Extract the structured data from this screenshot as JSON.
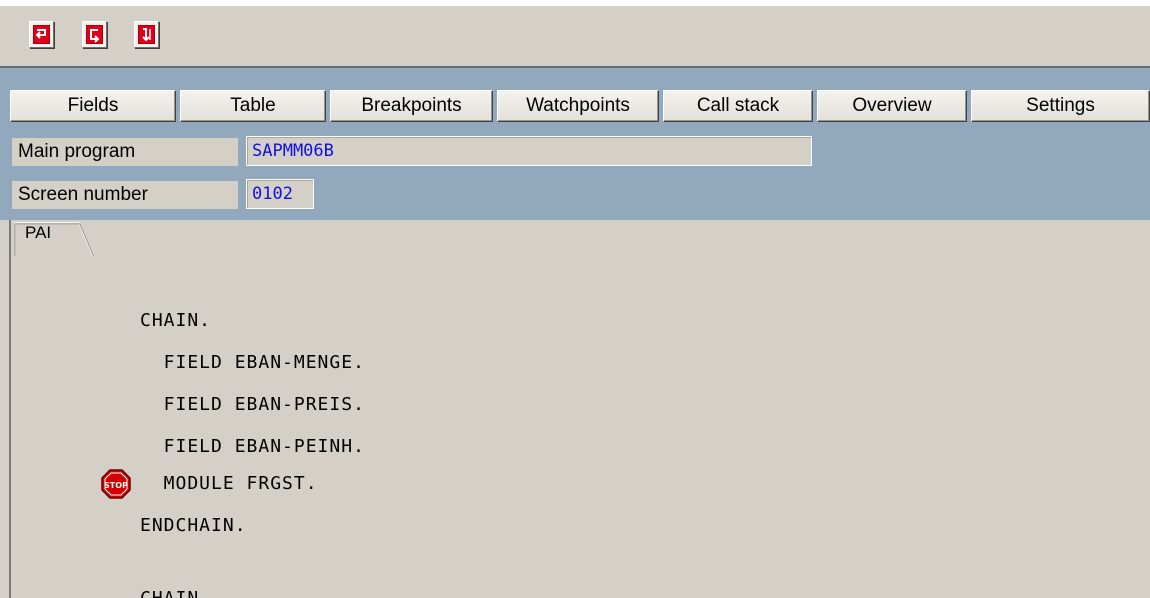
{
  "toolbar": {
    "buttons": [
      {
        "icon": "return-arrow-icon"
      },
      {
        "icon": "continue-loop-icon"
      },
      {
        "icon": "return-down-icon"
      }
    ]
  },
  "tabs": [
    {
      "label": "Fields"
    },
    {
      "label": "Table"
    },
    {
      "label": "Breakpoints"
    },
    {
      "label": "Watchpoints"
    },
    {
      "label": "Call stack"
    },
    {
      "label": "Overview"
    },
    {
      "label": "Settings"
    }
  ],
  "fields": {
    "main_program": {
      "label": "Main program",
      "value": "SAPMM06B"
    },
    "screen_number": {
      "label": "Screen number",
      "value": "0102"
    }
  },
  "pane": {
    "tab_label": "PAI",
    "lines": [
      "CHAIN.",
      "  FIELD EBAN-MENGE.",
      "  FIELD EBAN-PREIS.",
      "  FIELD EBAN-PEINH.",
      "  MODULE FRGST.",
      "ENDCHAIN.",
      "",
      "CHAIN."
    ],
    "breakpoint_icon": "stop-sign-icon"
  },
  "colors": {
    "header_blue": "#92a8bd",
    "value_blue": "#1010e0",
    "stop_red": "#d20000"
  }
}
